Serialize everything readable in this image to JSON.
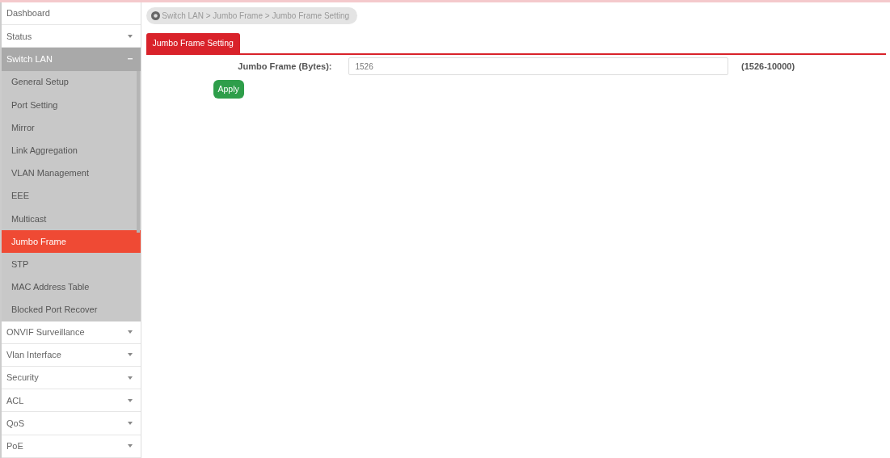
{
  "sidebar": {
    "items": [
      {
        "label": "Dashboard"
      },
      {
        "label": "Status",
        "expanded": false
      },
      {
        "label": "Switch LAN",
        "expanded": true,
        "children": [
          {
            "label": "General Setup",
            "selected": false
          },
          {
            "label": "Port Setting",
            "selected": false
          },
          {
            "label": "Mirror",
            "selected": false
          },
          {
            "label": "Link Aggregation",
            "selected": false
          },
          {
            "label": "VLAN Management",
            "selected": false
          },
          {
            "label": "EEE",
            "selected": false
          },
          {
            "label": "Multicast",
            "selected": false
          },
          {
            "label": "Jumbo Frame",
            "selected": true
          },
          {
            "label": "STP",
            "selected": false
          },
          {
            "label": "MAC Address Table",
            "selected": false
          },
          {
            "label": "Blocked Port Recover",
            "selected": false
          }
        ]
      },
      {
        "label": "ONVIF Surveillance",
        "expanded": false
      },
      {
        "label": "Vlan Interface",
        "expanded": false
      },
      {
        "label": "Security",
        "expanded": false
      },
      {
        "label": "ACL",
        "expanded": false
      },
      {
        "label": "QoS",
        "expanded": false
      },
      {
        "label": "PoE",
        "expanded": false
      }
    ]
  },
  "breadcrumb": "Switch LAN > Jumbo Frame > Jumbo Frame Setting",
  "tabs": [
    {
      "label": "Jumbo Frame Setting",
      "selected": true
    }
  ],
  "form": {
    "label": "Jumbo Frame (Bytes):",
    "value": "1526",
    "range": "(1526-10000)"
  },
  "apply_button": "Apply"
}
